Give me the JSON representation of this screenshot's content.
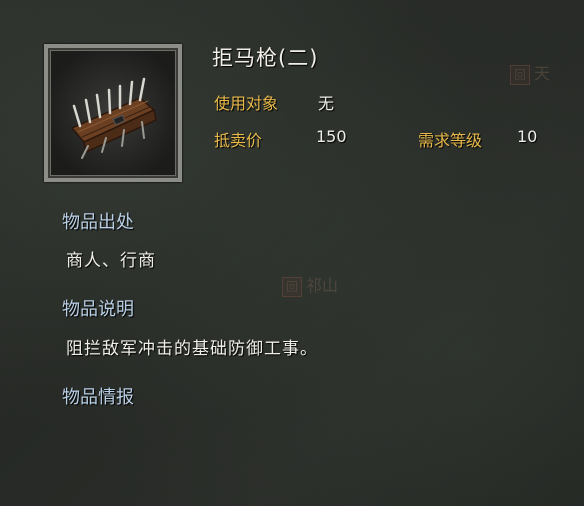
{
  "item": {
    "name": "拒马枪(二)",
    "icon": "cheval-de-frise-icon"
  },
  "stats": {
    "target_label": "使用对象",
    "target_value": "无",
    "price_label": "抵卖价",
    "price_value": "150",
    "level_label": "需求等级",
    "level_value": "10"
  },
  "sections": {
    "origin_label": "物品出处",
    "origin_text": "商人、行商",
    "desc_label": "物品说明",
    "desc_text": "阻拦敌军冲击的基础防御工事。",
    "intel_label": "物品情报"
  },
  "background": {
    "mark_right": "天",
    "mark_center": "祁山"
  },
  "colors": {
    "label_gold": "#e7b84a",
    "section_blue": "#b9cfe5",
    "text_white": "#f0eee8"
  }
}
